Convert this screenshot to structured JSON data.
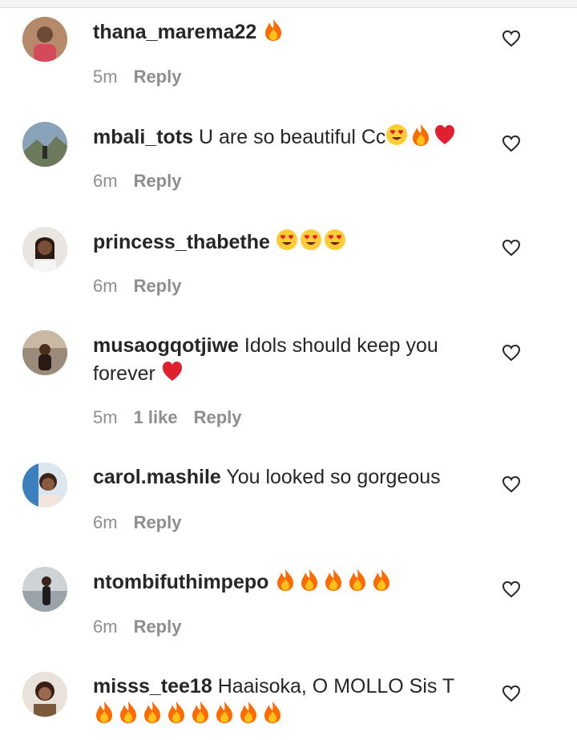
{
  "comments": [
    {
      "username": "thana_marema22",
      "text": "",
      "emojis": [
        "fire"
      ],
      "time": "5m",
      "likes": "",
      "reply": "Reply",
      "avatar": "avatar-1"
    },
    {
      "username": "mbali_tots",
      "text": "U are so beautiful Cc",
      "emojis": [
        "heart-eyes",
        "fire",
        "red-heart"
      ],
      "time": "6m",
      "likes": "",
      "reply": "Reply",
      "avatar": "avatar-2"
    },
    {
      "username": "princess_thabethe",
      "text": "",
      "emojis": [
        "heart-eyes",
        "heart-eyes",
        "heart-eyes"
      ],
      "time": "6m",
      "likes": "",
      "reply": "Reply",
      "avatar": "avatar-3"
    },
    {
      "username": "musaogqotjiwe",
      "text": "Idols should keep you forever",
      "emojis": [
        "red-heart"
      ],
      "time": "5m",
      "likes": "1 like",
      "reply": "Reply",
      "avatar": "avatar-4"
    },
    {
      "username": "carol.mashile",
      "text": "You looked so gorgeous",
      "emojis": [],
      "time": "6m",
      "likes": "",
      "reply": "Reply",
      "avatar": "avatar-5"
    },
    {
      "username": "ntombifuthimpepo",
      "text": "",
      "emojis": [
        "fire",
        "fire",
        "fire",
        "fire",
        "fire"
      ],
      "time": "6m",
      "likes": "",
      "reply": "Reply",
      "avatar": "avatar-6"
    },
    {
      "username": "misss_tee18",
      "text": "Haaisoka, O MOLLO Sis T",
      "emojis": [
        "fire",
        "fire",
        "fire",
        "fire",
        "fire",
        "fire",
        "fire",
        "fire"
      ],
      "time": "",
      "likes": "",
      "reply": "",
      "avatar": "avatar-7"
    }
  ],
  "icons": {
    "like": "heart-outline-icon"
  },
  "colors": {
    "text": "#262626",
    "meta": "#8e8e8e",
    "fire": "#ff6a00",
    "heart": "#e0202f",
    "emoji_face": "#ffcc33"
  }
}
